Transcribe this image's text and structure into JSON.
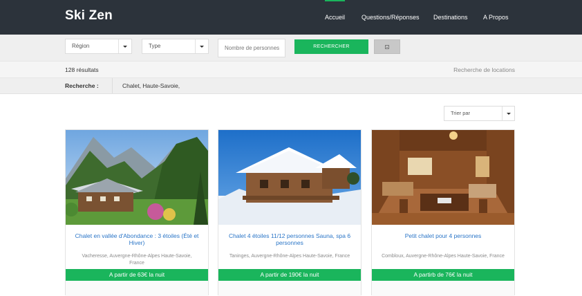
{
  "header": {
    "logo": "Ski Zen",
    "nav": [
      {
        "label": "Accueil",
        "active": true
      },
      {
        "label": "Questions/Réponses",
        "active": false
      },
      {
        "label": "Destinations",
        "active": false
      },
      {
        "label": "A Propos",
        "active": false
      }
    ]
  },
  "filters": {
    "region_placeholder": "Région",
    "type_placeholder": "Type",
    "people_placeholder": "Nombre de personnes",
    "search_button": "RECHERCHER",
    "extra_button_icon": "plus-square-icon"
  },
  "results": {
    "count": "128 résultats",
    "link": "Recherche de locations"
  },
  "search_summary": {
    "label": "Recherche :",
    "value": "Chalet, Haute-Savoie,"
  },
  "sort": {
    "placeholder": "Trier par"
  },
  "listings": [
    {
      "title": "Chalet en vallée d'Abondance : 3 étoiles (Été et Hiver)",
      "location": "Vacheresse, Auvergne-Rhône-Alpes Haute-Savoie, France",
      "price": "A partir de 63€ la nuit",
      "image": "summer-chalet-mountains"
    },
    {
      "title": "Chalet 4 étoiles 11/12 personnes Sauna, spa 6 personnes",
      "location": "Taninges, Auvergne-Rhône-Alpes Haute-Savoie, France",
      "price": "A partir de 190€ la nuit",
      "image": "snowy-chalet"
    },
    {
      "title": "Petit chalet pour 4 personnes",
      "location": "Combloux, Auvergne-Rhône-Alpes Haute-Savoie, France",
      "price": "A partirb de 76€ la nuit",
      "image": "wooden-chalet-interior"
    }
  ],
  "colors": {
    "header_bg": "#2c333b",
    "accent": "#1ab55c",
    "link": "#2a75c7"
  }
}
